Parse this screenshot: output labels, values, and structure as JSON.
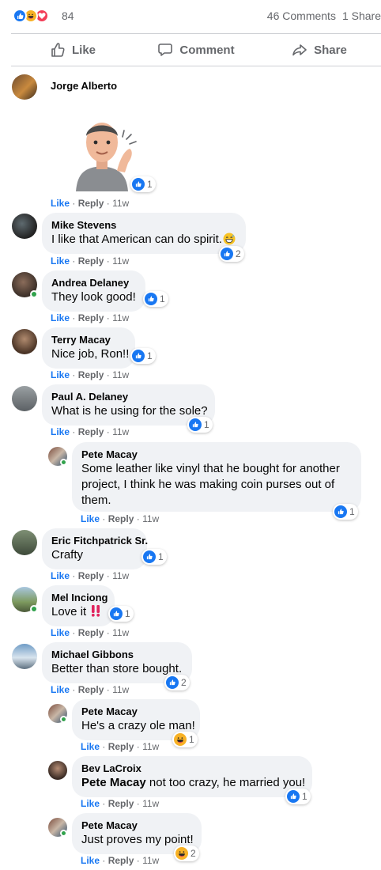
{
  "summary": {
    "reaction_count": "84",
    "comments": "46 Comments",
    "shares": "1 Share"
  },
  "actions": {
    "like": "Like",
    "comment": "Comment",
    "share": "Share"
  },
  "labels": {
    "like": "Like",
    "reply": "Reply",
    "sep": "·"
  },
  "colors": {
    "link_blue": "#1877f2",
    "bubble_gray": "#f0f2f5",
    "meta_gray": "#65676b",
    "online_green": "#31a24c"
  },
  "comments": [
    {
      "author": "Jorge Alberto",
      "text": "",
      "time": "11w",
      "reaction_icon": "like",
      "reaction_count": "1",
      "attachment": "avatar-sticker"
    },
    {
      "author": "Mike Stevens",
      "text": "I like that American can do spirit.",
      "emoji": "grinning-sweat-emoji",
      "time": "11w",
      "reaction_icon": "like",
      "reaction_count": "2"
    },
    {
      "author": "Andrea Delaney",
      "text": "They look good!",
      "time": "11w",
      "reaction_icon": "like",
      "reaction_count": "1",
      "online": true
    },
    {
      "author": "Terry Macay",
      "text": "Nice job, Ron!!",
      "time": "11w",
      "reaction_icon": "like",
      "reaction_count": "1"
    },
    {
      "author": "Paul A. Delaney",
      "text": "What is he using for the sole?",
      "time": "11w",
      "reaction_icon": "like",
      "reaction_count": "1"
    },
    {
      "author": "Pete Macay",
      "text": "Some leather like vinyl that he bought for another project, I think he was making coin purses out of them.",
      "time": "11w",
      "reaction_icon": "like",
      "reaction_count": "1",
      "online": true
    },
    {
      "author": "Eric Fitchpatrick Sr.",
      "text": "Crafty",
      "time": "11w",
      "reaction_icon": "like",
      "reaction_count": "1"
    },
    {
      "author": "Mel Inciong",
      "text": "Love it",
      "emoji": "double-exclamation-emoji",
      "time": "11w",
      "reaction_icon": "like",
      "reaction_count": "1",
      "online": true
    },
    {
      "author": "Michael Gibbons",
      "text": "Better than store bought.",
      "time": "11w",
      "reaction_icon": "like",
      "reaction_count": "2"
    },
    {
      "author": "Pete Macay",
      "text": "He's a crazy ole man!",
      "time": "11w",
      "reaction_icon": "haha",
      "reaction_count": "1",
      "online": true
    },
    {
      "author": "Bev LaCroix",
      "mention": "Pete Macay",
      "text": " not too crazy, he married you!",
      "time": "11w",
      "reaction_icon": "like",
      "reaction_count": "1"
    },
    {
      "author": "Pete Macay",
      "text": "Just proves my point!",
      "time": "11w",
      "reaction_icon": "haha",
      "reaction_count": "2",
      "online": true
    }
  ]
}
